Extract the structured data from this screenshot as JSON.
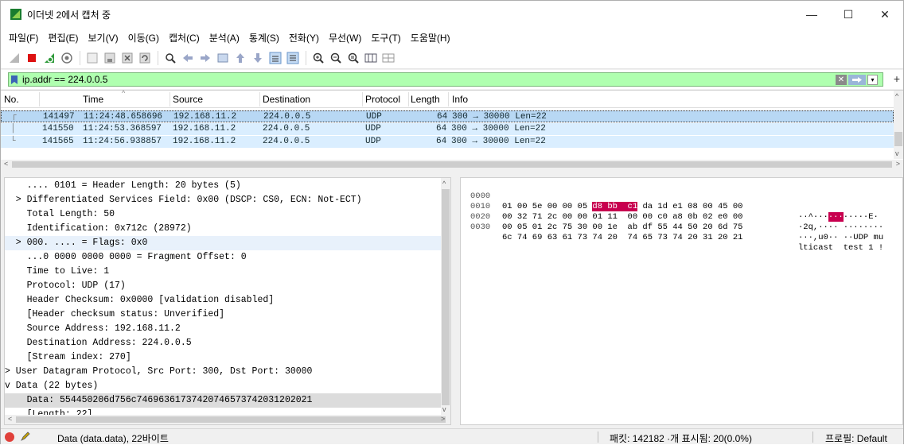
{
  "window": {
    "title": "이더넷 2에서 캡처 중",
    "minimize": "—",
    "maximize": "☐",
    "close": "✕"
  },
  "menu": [
    "파일(F)",
    "편집(E)",
    "보기(V)",
    "이동(G)",
    "캡처(C)",
    "분석(A)",
    "통계(S)",
    "전화(Y)",
    "무선(W)",
    "도구(T)",
    "도움말(H)"
  ],
  "filter": {
    "value": "ip.addr == 224.0.0.5",
    "clear": "✕",
    "add": "+"
  },
  "columns": [
    "No.",
    "Time",
    "Source",
    "Destination",
    "Protocol",
    "Length",
    "Info"
  ],
  "packets": [
    {
      "no": "141497",
      "time": "11:24:48.658696",
      "source": "192.168.11.2",
      "destination": "224.0.0.5",
      "protocol": "UDP",
      "length": "64",
      "info": "300 → 30000 Len=22"
    },
    {
      "no": "141550",
      "time": "11:24:53.368597",
      "source": "192.168.11.2",
      "destination": "224.0.0.5",
      "protocol": "UDP",
      "length": "64",
      "info": "300 → 30000 Len=22"
    },
    {
      "no": "141565",
      "time": "11:24:56.938857",
      "source": "192.168.11.2",
      "destination": "224.0.0.5",
      "protocol": "UDP",
      "length": "64",
      "info": "300 → 30000 Len=22"
    }
  ],
  "details": [
    "    .... 0101 = Header Length: 20 bytes (5)",
    "  > Differentiated Services Field: 0x00 (DSCP: CS0, ECN: Not-ECT)",
    "    Total Length: 50",
    "    Identification: 0x712c (28972)",
    "  > 000. .... = Flags: 0x0",
    "    ...0 0000 0000 0000 = Fragment Offset: 0",
    "    Time to Live: 1",
    "    Protocol: UDP (17)",
    "    Header Checksum: 0x0000 [validation disabled]",
    "    [Header checksum status: Unverified]",
    "    Source Address: 192.168.11.2",
    "    Destination Address: 224.0.0.5",
    "    [Stream index: 270]",
    "> User Datagram Protocol, Src Port: 300, Dst Port: 30000",
    "v Data (22 bytes)",
    "    Data: 554450206d756c74696361737420746573742031202021",
    "    [Length: 22]"
  ],
  "hex": [
    {
      "off": "0000",
      "bytes_a": "01 00 5e 00 00 05 ",
      "bytes_hl": "d8 bb  c1",
      "bytes_b": " da 1d e1 08 00 45 00",
      "ascii_a": "··^···",
      "ascii_hl": "···",
      "ascii_b": "·····E·"
    },
    {
      "off": "0010",
      "bytes_a": "00 32 71 2c 00 00 01 11  00 00 c0 a8 0b 02 e0 00",
      "bytes_hl": "",
      "bytes_b": "",
      "ascii_a": "·2q,···· ········",
      "ascii_hl": "",
      "ascii_b": ""
    },
    {
      "off": "0020",
      "bytes_a": "00 05 01 2c 75 30 00 1e  ab df 55 44 50 20 6d 75",
      "bytes_hl": "",
      "bytes_b": "",
      "ascii_a": "···,u0·· ··UDP mu",
      "ascii_hl": "",
      "ascii_b": ""
    },
    {
      "off": "0030",
      "bytes_a": "6c 74 69 63 61 73 74 20  74 65 73 74 20 31 20 21",
      "bytes_hl": "",
      "bytes_b": "",
      "ascii_a": "lticast  test 1 !",
      "ascii_hl": "",
      "ascii_b": ""
    }
  ],
  "status": {
    "field": "Data (data.data), 22바이트",
    "packets": "패킷: 142182 ·개 표시됨: 20(0.0%)",
    "profile": "프로필: Default"
  },
  "colors": {
    "filter_ok": "#afffaf",
    "row_selected": "#b8d8f4",
    "row_normal": "#daeeff",
    "byte_highlight": "#c8004f"
  }
}
